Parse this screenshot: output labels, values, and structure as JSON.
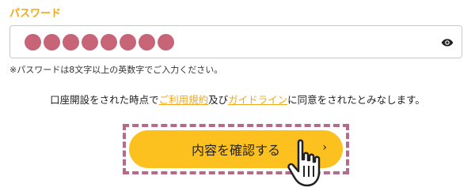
{
  "form": {
    "password_label": "パスワード",
    "password_mask_count": 8,
    "password_hint": "※パスワードは8文字以上の英数字でご入力ください。",
    "show_password_icon": "eye-icon"
  },
  "agreement": {
    "prefix": "口座開設をされた時点で",
    "terms_link": "ご利用規約",
    "connector": "及び",
    "guideline_link": "ガイドライン",
    "suffix": "に同意をされたとみなします。"
  },
  "actions": {
    "confirm_label": "内容を確認する",
    "confirm_icon": "chevron-right-icon"
  },
  "colors": {
    "accent": "#f0a81c",
    "button": "#fcc11e",
    "mask_dot": "#c76478",
    "highlight_border": "#b56a88"
  }
}
